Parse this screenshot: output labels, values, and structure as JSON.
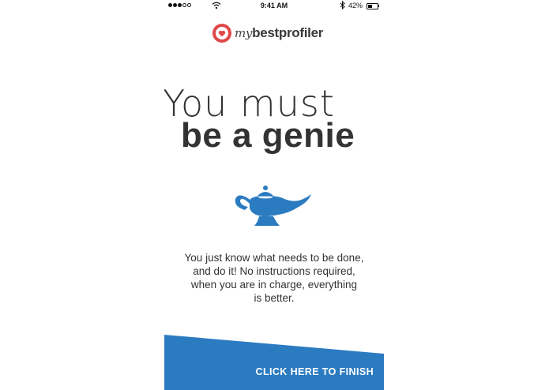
{
  "status_bar": {
    "time": "9:41 AM",
    "battery": "42%",
    "battery_level": 0.42,
    "signal_bars_filled": 3,
    "signal_bars_total": 5
  },
  "brand": {
    "my": "my",
    "best": "best",
    "profiler": "profiler",
    "logo_color": "#e04848"
  },
  "result": {
    "headline_line1": "You must",
    "headline_line2": "be a genie",
    "icon": "genie-lamp-icon",
    "description_lines": [
      "You just know what needs to be done,",
      "and do it! No instructions required,",
      "when you are in charge, everything",
      "is better."
    ]
  },
  "cta": {
    "label": "CLICK HERE TO FINISH",
    "color": "#2b7bc1"
  },
  "colors": {
    "accent": "#2b7bc1",
    "text": "#333333"
  }
}
